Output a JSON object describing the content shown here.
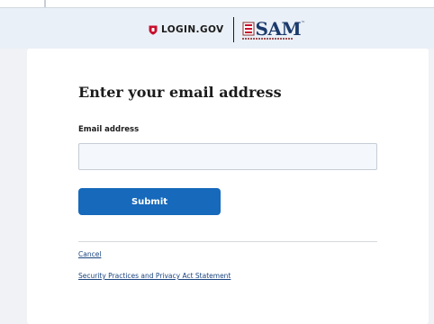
{
  "header": {
    "login_logo_text": "LOGIN.GOV",
    "partner_logo_text": "SAM",
    "partner_logo_tm": "™",
    "icons": [
      "shield-icon",
      "sam-eagle-icon"
    ]
  },
  "form": {
    "heading": "Enter your email address",
    "email_label": "Email address",
    "email_value": "",
    "submit_label": "Submit"
  },
  "footer_links": {
    "cancel": "Cancel",
    "privacy": "Security Practices and Privacy Act Statement"
  },
  "colors": {
    "primary_button": "#1669bb",
    "link": "#1a4480",
    "banner_bg": "#eaf0f7",
    "logo_red": "#c8102e",
    "sam_navy": "#1b3a6b"
  }
}
